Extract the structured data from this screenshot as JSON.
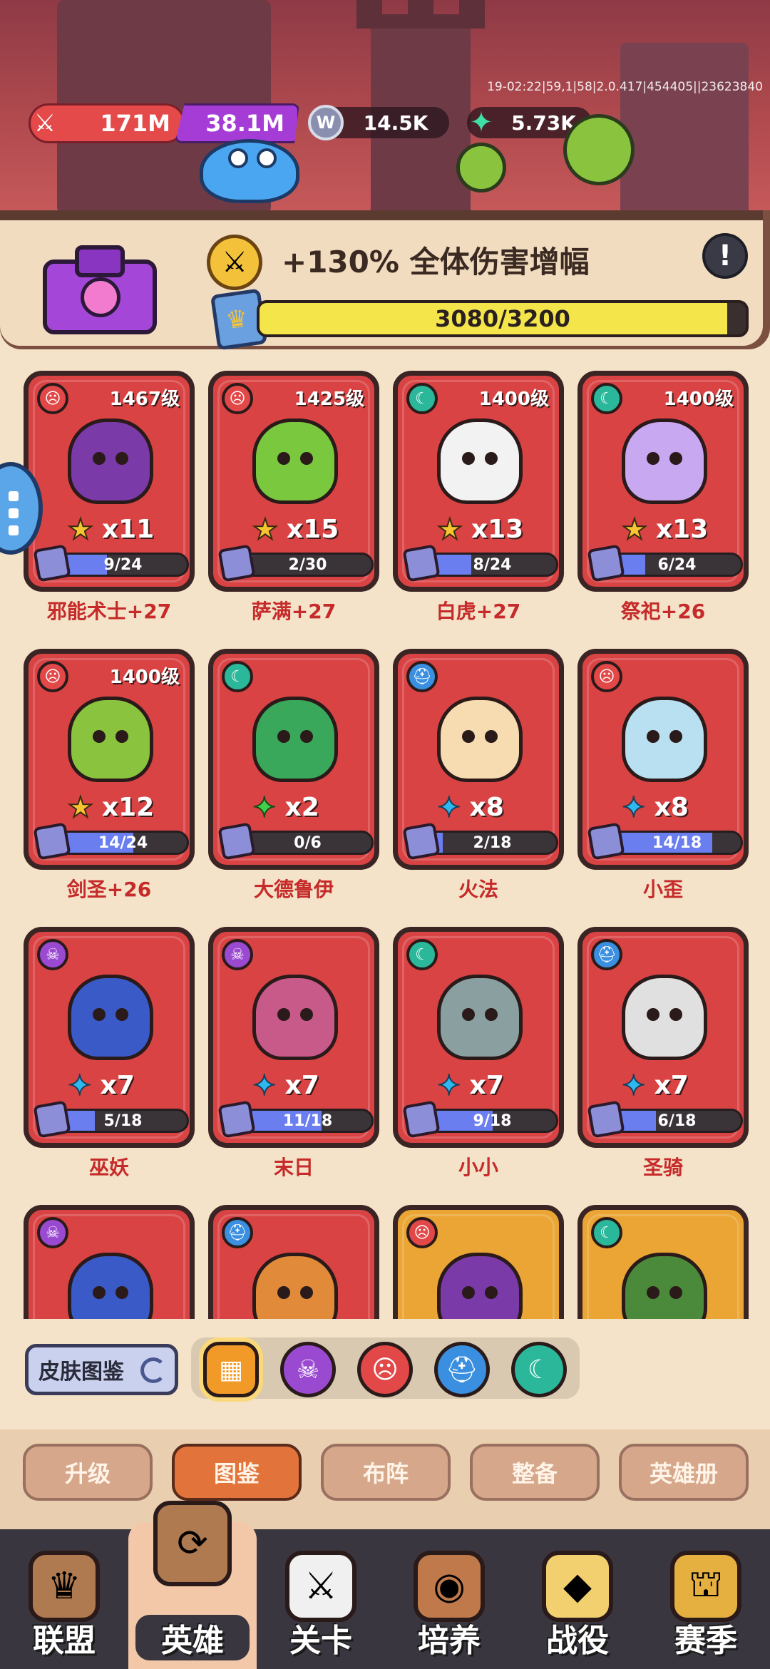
{
  "debug_text": "19-02:22|59,1|58|2.0.417|454405||23623840",
  "resources": {
    "attack": "171M",
    "energy": "38.1M",
    "coin_icon_letter": "W",
    "coins": "14.5K",
    "gems": "5.73K"
  },
  "power_panel": {
    "bonus_text": "+130% 全体伤害增幅",
    "progress_text": "3080/3200",
    "progress_fraction": 0.9625
  },
  "heroes": [
    {
      "name": "邪能术士+27",
      "level": "1467级",
      "faction": "red",
      "star": "gold",
      "mult": "x11",
      "frag": "9/24",
      "color": "#7a3aa8"
    },
    {
      "name": "萨满+27",
      "level": "1425级",
      "faction": "red",
      "star": "gold",
      "mult": "x15",
      "frag": "2/30",
      "color": "#7ac83e"
    },
    {
      "name": "白虎+27",
      "level": "1400级",
      "faction": "teal",
      "star": "gold",
      "mult": "x13",
      "frag": "8/24",
      "color": "#f2f2f2"
    },
    {
      "name": "祭祀+26",
      "level": "1400级",
      "faction": "teal",
      "star": "gold",
      "mult": "x13",
      "frag": "6/24",
      "color": "#c8a8f0"
    },
    {
      "name": "剑圣+26",
      "level": "1400级",
      "faction": "red",
      "star": "gold",
      "mult": "x12",
      "frag": "14/24",
      "color": "#8ac43e"
    },
    {
      "name": "大德鲁伊",
      "level": "",
      "faction": "teal",
      "star": "green",
      "mult": "x2",
      "frag": "0/6",
      "color": "#3aa85a"
    },
    {
      "name": "火法",
      "level": "",
      "faction": "blue",
      "star": "blue",
      "mult": "x8",
      "frag": "2/18",
      "color": "#f6dcb0"
    },
    {
      "name": "小歪",
      "level": "",
      "faction": "red",
      "star": "blue",
      "mult": "x8",
      "frag": "14/18",
      "color": "#b8e0f0"
    },
    {
      "name": "巫妖",
      "level": "",
      "faction": "purple",
      "star": "blue",
      "mult": "x7",
      "frag": "5/18",
      "color": "#3a5ac8"
    },
    {
      "name": "末日",
      "level": "",
      "faction": "purple",
      "star": "blue",
      "mult": "x7",
      "frag": "11/18",
      "color": "#c85a8a"
    },
    {
      "name": "小小",
      "level": "",
      "faction": "teal",
      "star": "blue",
      "mult": "x7",
      "frag": "9/18",
      "color": "#8aa0a0"
    },
    {
      "name": "圣骑",
      "level": "",
      "faction": "blue",
      "star": "blue",
      "mult": "x7",
      "frag": "6/18",
      "color": "#e0e0e0"
    },
    {
      "name": "",
      "level": "",
      "faction": "purple",
      "star": "",
      "mult": "",
      "frag": "",
      "color": "#3a5ac8",
      "card": "red"
    },
    {
      "name": "",
      "level": "",
      "faction": "blue",
      "star": "",
      "mult": "",
      "frag": "",
      "color": "#e08a3a",
      "card": "red"
    },
    {
      "name": "",
      "level": "",
      "faction": "red",
      "star": "",
      "mult": "",
      "frag": "",
      "color": "#7a3aa8",
      "card": "gold"
    },
    {
      "name": "",
      "level": "",
      "faction": "teal",
      "star": "",
      "mult": "",
      "frag": "",
      "color": "#4a8a3a",
      "card": "gold"
    }
  ],
  "filter": {
    "skin_label": "皮肤图鉴",
    "buttons": [
      "all",
      "purple",
      "red",
      "blue",
      "teal"
    ]
  },
  "subtabs": [
    "升级",
    "图鉴",
    "布阵",
    "整备",
    "英雄册"
  ],
  "subtab_active": 1,
  "nav": [
    "联盟",
    "英雄",
    "关卡",
    "培养",
    "战役",
    "赛季"
  ],
  "nav_active": 1,
  "colors": {
    "faction_red": "#e24848",
    "faction_teal": "#2bb89a",
    "faction_blue": "#3a8fe0",
    "faction_purple": "#9a4ad0",
    "accent_orange": "#e2733a"
  }
}
